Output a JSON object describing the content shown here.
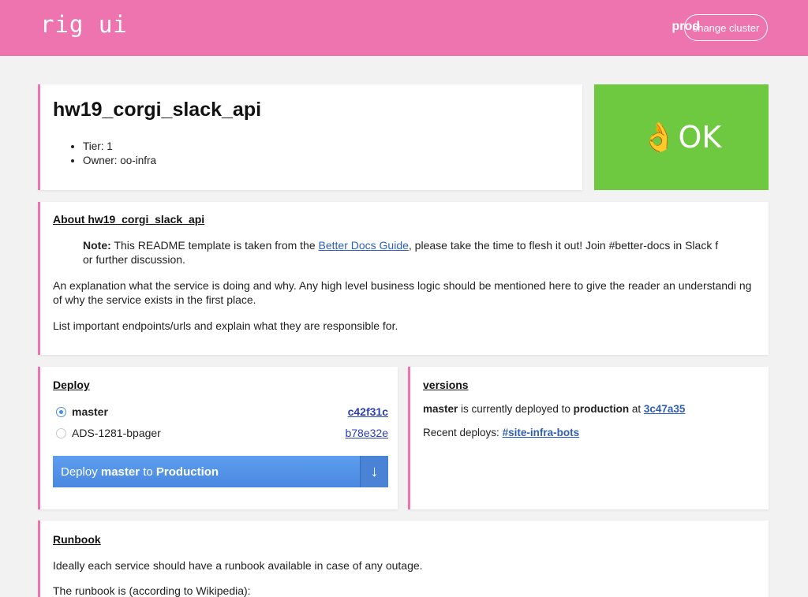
{
  "header": {
    "logo": "rig ui",
    "cluster": "prod",
    "change_cluster": "change cluster",
    "bg_color": "#ee74af"
  },
  "service": {
    "name": "hw19_corgi_slack_api",
    "tier": "Tier: 1",
    "owner": "Owner: oo-infra"
  },
  "status": {
    "emoji": "👌",
    "text": "OK",
    "color": "#6fc940"
  },
  "about": {
    "heading": "About hw19_corgi_slack_api",
    "note_label": "Note:",
    "note_pre": " This README template is taken from the ",
    "note_link": "Better Docs Guide",
    "note_post": ", please take the time to flesh it out! Join #better-docs in Slack f or further discussion.",
    "para1": "An explanation what the service is doing and why. Any high level business logic should be mentioned here to give the reader an understandi ng of why the service exists in the first place.",
    "para2": "List important endpoints/urls and explain what they are responsible for."
  },
  "deploy": {
    "heading": "Deploy",
    "branches": [
      {
        "name": "master",
        "commit": "c42f31c",
        "selected": true
      },
      {
        "name": "ADS-1281-bpager",
        "commit": "b78e32e",
        "selected": false
      }
    ],
    "button_pre": "Deploy ",
    "button_branch": "master",
    "button_mid": " to ",
    "button_env": "Production",
    "button_arrow": "↓"
  },
  "versions": {
    "heading": "versions",
    "branch": "master",
    "text1": " is currently deployed to ",
    "env": "production",
    "text2": " at ",
    "commit": "3c47a35",
    "recent_label": "Recent deploys: ",
    "recent_link": "#site-infra-bots"
  },
  "runbook": {
    "heading": "Runbook",
    "para1": "Ideally each service should have a runbook available in case of any outage.",
    "para2": "The runbook is (according to Wikipedia):"
  }
}
